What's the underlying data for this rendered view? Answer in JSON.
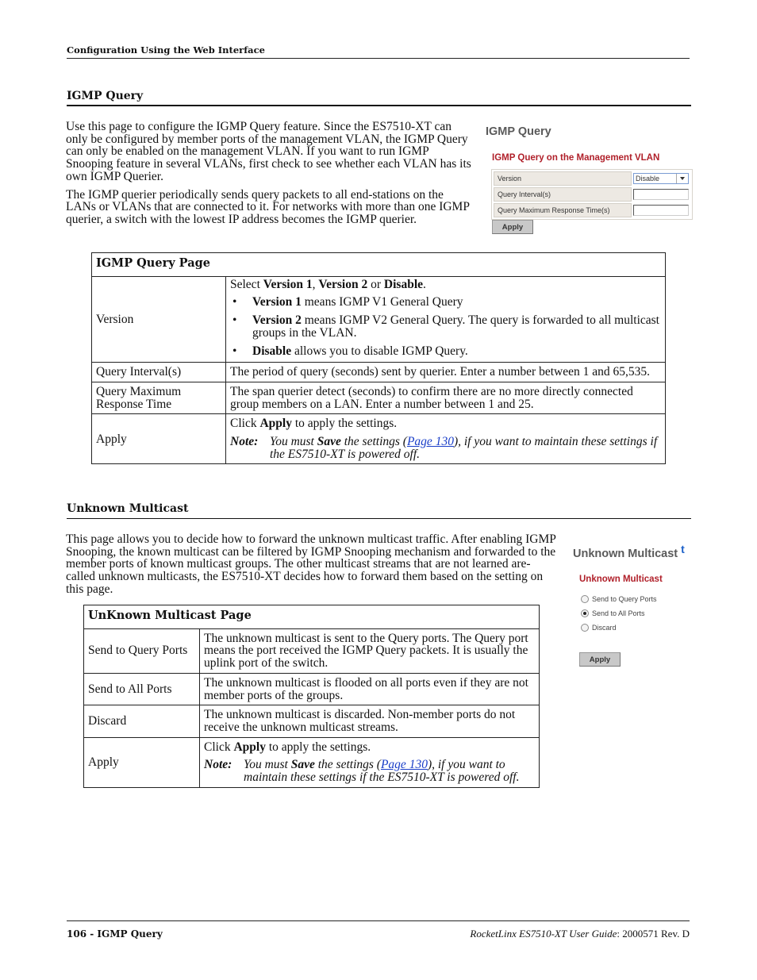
{
  "running_header": "Configuration Using the Web Interface",
  "igmp_query": {
    "title": "IGMP Query",
    "paragraphs": [
      "Use this page to configure the IGMP Query feature. Since the ES7510-XT can only be configured by member ports of the management VLAN, the IGMP Query can only be enabled on the management VLAN. If you want to run IGMP Snooping feature in several VLANs, first check to see whether each VLAN has its own IGMP Querier.",
      "The IGMP querier periodically sends query packets to all end-stations on the LANs or VLANs that are connected to it. For networks with more than one IGMP querier, a switch with the lowest IP address becomes the IGMP querier."
    ],
    "screenshot": {
      "title": "IGMP Query",
      "subtitle": "IGMP Query on the Management VLAN",
      "rows": [
        {
          "label": "Version",
          "type": "select",
          "value": "Disable"
        },
        {
          "label": "Query Interval(s)",
          "type": "input",
          "value": ""
        },
        {
          "label": "Query Maximum Response Time(s)",
          "type": "input",
          "value": ""
        }
      ],
      "apply_label": "Apply"
    },
    "table": {
      "header": "IGMP Query Page",
      "version": {
        "label": "Version",
        "intro_prefix": "Select ",
        "intro_v1": "Version 1",
        "intro_sep": ", ",
        "intro_v2": "Version 2",
        "intro_or": " or ",
        "intro_disable": "Disable",
        "intro_end": ".",
        "bullets": [
          {
            "bold": "Version 1",
            "text": " means IGMP V1 General Query"
          },
          {
            "bold": "Version 2",
            "text": " means IGMP V2 General Query. The query is forwarded to all multicast groups in the VLAN."
          },
          {
            "bold": "Disable",
            "text": " allows you to disable IGMP Query."
          }
        ]
      },
      "query_interval": {
        "label": "Query Interval(s)",
        "desc": "The period of query (seconds) sent by querier. Enter a number between 1 and 65,535."
      },
      "query_max": {
        "label": "Query Maximum Response Time",
        "desc": "The span querier detect (seconds) to confirm there are no more directly connected group members on a LAN. Enter a number between 1 and 25."
      },
      "apply": {
        "label": "Apply",
        "click_prefix": "Click ",
        "click_bold": "Apply",
        "click_suffix": " to apply the settings.",
        "note_label": "Note:",
        "note_prefix": "You must ",
        "note_bold": "Save",
        "note_mid": " the settings (",
        "note_link": "Page 130",
        "note_suffix": "), if you want to maintain these settings if the ES7510-XT is powered off."
      }
    }
  },
  "unknown_multicast": {
    "title": "Unknown Multicast",
    "paragraph": "This page allows you to decide how to forward the unknown multicast traffic. After enabling IGMP Snooping, the known multicast can be filtered by IGMP Snooping mechanism and forwarded to the member ports of known multicast groups. The other multicast streams that are not learned are-called unknown multicasts, the ES7510-XT decides how to forward them based on the setting on this page.",
    "screenshot": {
      "title": "Unknown Multicast",
      "title_suffix": "t",
      "subtitle": "Unknown Multicast",
      "options": [
        {
          "label": "Send to Query Ports",
          "checked": false
        },
        {
          "label": "Send to All Ports",
          "checked": true
        },
        {
          "label": "Discard",
          "checked": false
        }
      ],
      "apply_label": "Apply"
    },
    "table": {
      "header": "UnKnown Multicast Page",
      "rows": [
        {
          "label": "Send to Query Ports",
          "desc": "The unknown multicast is sent to the Query ports. The Query port means the port received the IGMP Query packets. It is usually the uplink port of the switch."
        },
        {
          "label": "Send to All Ports",
          "desc": "The unknown multicast is flooded on all ports even if they are not member ports of the groups."
        },
        {
          "label": "Discard",
          "desc": "The unknown multicast is discarded. Non-member ports do not receive the unknown multicast streams."
        }
      ],
      "apply": {
        "label": "Apply",
        "click_prefix": "Click ",
        "click_bold": "Apply",
        "click_suffix": " to apply the settings.",
        "note_label": "Note:",
        "note_prefix": "You must ",
        "note_bold": "Save",
        "note_mid": " the settings (",
        "note_link": "Page 130",
        "note_suffix": "), if you want to maintain these settings if the ES7510-XT is powered off."
      }
    }
  },
  "footer": {
    "left": "106 - IGMP Query",
    "right_italic": "RocketLinx ES7510-XT  User Guide",
    "right_plain": ": 2000571 Rev. D"
  }
}
